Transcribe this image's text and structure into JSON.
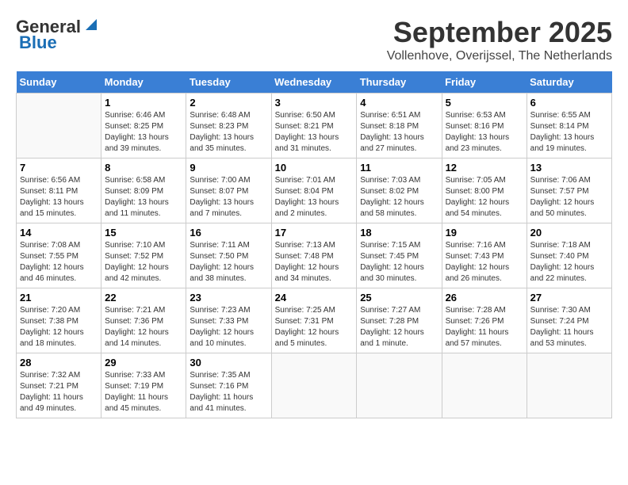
{
  "header": {
    "logo_general": "General",
    "logo_blue": "Blue",
    "month_title": "September 2025",
    "subtitle": "Vollenhove, Overijssel, The Netherlands"
  },
  "days_of_week": [
    "Sunday",
    "Monday",
    "Tuesday",
    "Wednesday",
    "Thursday",
    "Friday",
    "Saturday"
  ],
  "weeks": [
    [
      {
        "day": "",
        "info": ""
      },
      {
        "day": "1",
        "info": "Sunrise: 6:46 AM\nSunset: 8:25 PM\nDaylight: 13 hours\nand 39 minutes."
      },
      {
        "day": "2",
        "info": "Sunrise: 6:48 AM\nSunset: 8:23 PM\nDaylight: 13 hours\nand 35 minutes."
      },
      {
        "day": "3",
        "info": "Sunrise: 6:50 AM\nSunset: 8:21 PM\nDaylight: 13 hours\nand 31 minutes."
      },
      {
        "day": "4",
        "info": "Sunrise: 6:51 AM\nSunset: 8:18 PM\nDaylight: 13 hours\nand 27 minutes."
      },
      {
        "day": "5",
        "info": "Sunrise: 6:53 AM\nSunset: 8:16 PM\nDaylight: 13 hours\nand 23 minutes."
      },
      {
        "day": "6",
        "info": "Sunrise: 6:55 AM\nSunset: 8:14 PM\nDaylight: 13 hours\nand 19 minutes."
      }
    ],
    [
      {
        "day": "7",
        "info": "Sunrise: 6:56 AM\nSunset: 8:11 PM\nDaylight: 13 hours\nand 15 minutes."
      },
      {
        "day": "8",
        "info": "Sunrise: 6:58 AM\nSunset: 8:09 PM\nDaylight: 13 hours\nand 11 minutes."
      },
      {
        "day": "9",
        "info": "Sunrise: 7:00 AM\nSunset: 8:07 PM\nDaylight: 13 hours\nand 7 minutes."
      },
      {
        "day": "10",
        "info": "Sunrise: 7:01 AM\nSunset: 8:04 PM\nDaylight: 13 hours\nand 2 minutes."
      },
      {
        "day": "11",
        "info": "Sunrise: 7:03 AM\nSunset: 8:02 PM\nDaylight: 12 hours\nand 58 minutes."
      },
      {
        "day": "12",
        "info": "Sunrise: 7:05 AM\nSunset: 8:00 PM\nDaylight: 12 hours\nand 54 minutes."
      },
      {
        "day": "13",
        "info": "Sunrise: 7:06 AM\nSunset: 7:57 PM\nDaylight: 12 hours\nand 50 minutes."
      }
    ],
    [
      {
        "day": "14",
        "info": "Sunrise: 7:08 AM\nSunset: 7:55 PM\nDaylight: 12 hours\nand 46 minutes."
      },
      {
        "day": "15",
        "info": "Sunrise: 7:10 AM\nSunset: 7:52 PM\nDaylight: 12 hours\nand 42 minutes."
      },
      {
        "day": "16",
        "info": "Sunrise: 7:11 AM\nSunset: 7:50 PM\nDaylight: 12 hours\nand 38 minutes."
      },
      {
        "day": "17",
        "info": "Sunrise: 7:13 AM\nSunset: 7:48 PM\nDaylight: 12 hours\nand 34 minutes."
      },
      {
        "day": "18",
        "info": "Sunrise: 7:15 AM\nSunset: 7:45 PM\nDaylight: 12 hours\nand 30 minutes."
      },
      {
        "day": "19",
        "info": "Sunrise: 7:16 AM\nSunset: 7:43 PM\nDaylight: 12 hours\nand 26 minutes."
      },
      {
        "day": "20",
        "info": "Sunrise: 7:18 AM\nSunset: 7:40 PM\nDaylight: 12 hours\nand 22 minutes."
      }
    ],
    [
      {
        "day": "21",
        "info": "Sunrise: 7:20 AM\nSunset: 7:38 PM\nDaylight: 12 hours\nand 18 minutes."
      },
      {
        "day": "22",
        "info": "Sunrise: 7:21 AM\nSunset: 7:36 PM\nDaylight: 12 hours\nand 14 minutes."
      },
      {
        "day": "23",
        "info": "Sunrise: 7:23 AM\nSunset: 7:33 PM\nDaylight: 12 hours\nand 10 minutes."
      },
      {
        "day": "24",
        "info": "Sunrise: 7:25 AM\nSunset: 7:31 PM\nDaylight: 12 hours\nand 5 minutes."
      },
      {
        "day": "25",
        "info": "Sunrise: 7:27 AM\nSunset: 7:28 PM\nDaylight: 12 hours\nand 1 minute."
      },
      {
        "day": "26",
        "info": "Sunrise: 7:28 AM\nSunset: 7:26 PM\nDaylight: 11 hours\nand 57 minutes."
      },
      {
        "day": "27",
        "info": "Sunrise: 7:30 AM\nSunset: 7:24 PM\nDaylight: 11 hours\nand 53 minutes."
      }
    ],
    [
      {
        "day": "28",
        "info": "Sunrise: 7:32 AM\nSunset: 7:21 PM\nDaylight: 11 hours\nand 49 minutes."
      },
      {
        "day": "29",
        "info": "Sunrise: 7:33 AM\nSunset: 7:19 PM\nDaylight: 11 hours\nand 45 minutes."
      },
      {
        "day": "30",
        "info": "Sunrise: 7:35 AM\nSunset: 7:16 PM\nDaylight: 11 hours\nand 41 minutes."
      },
      {
        "day": "",
        "info": ""
      },
      {
        "day": "",
        "info": ""
      },
      {
        "day": "",
        "info": ""
      },
      {
        "day": "",
        "info": ""
      }
    ]
  ]
}
